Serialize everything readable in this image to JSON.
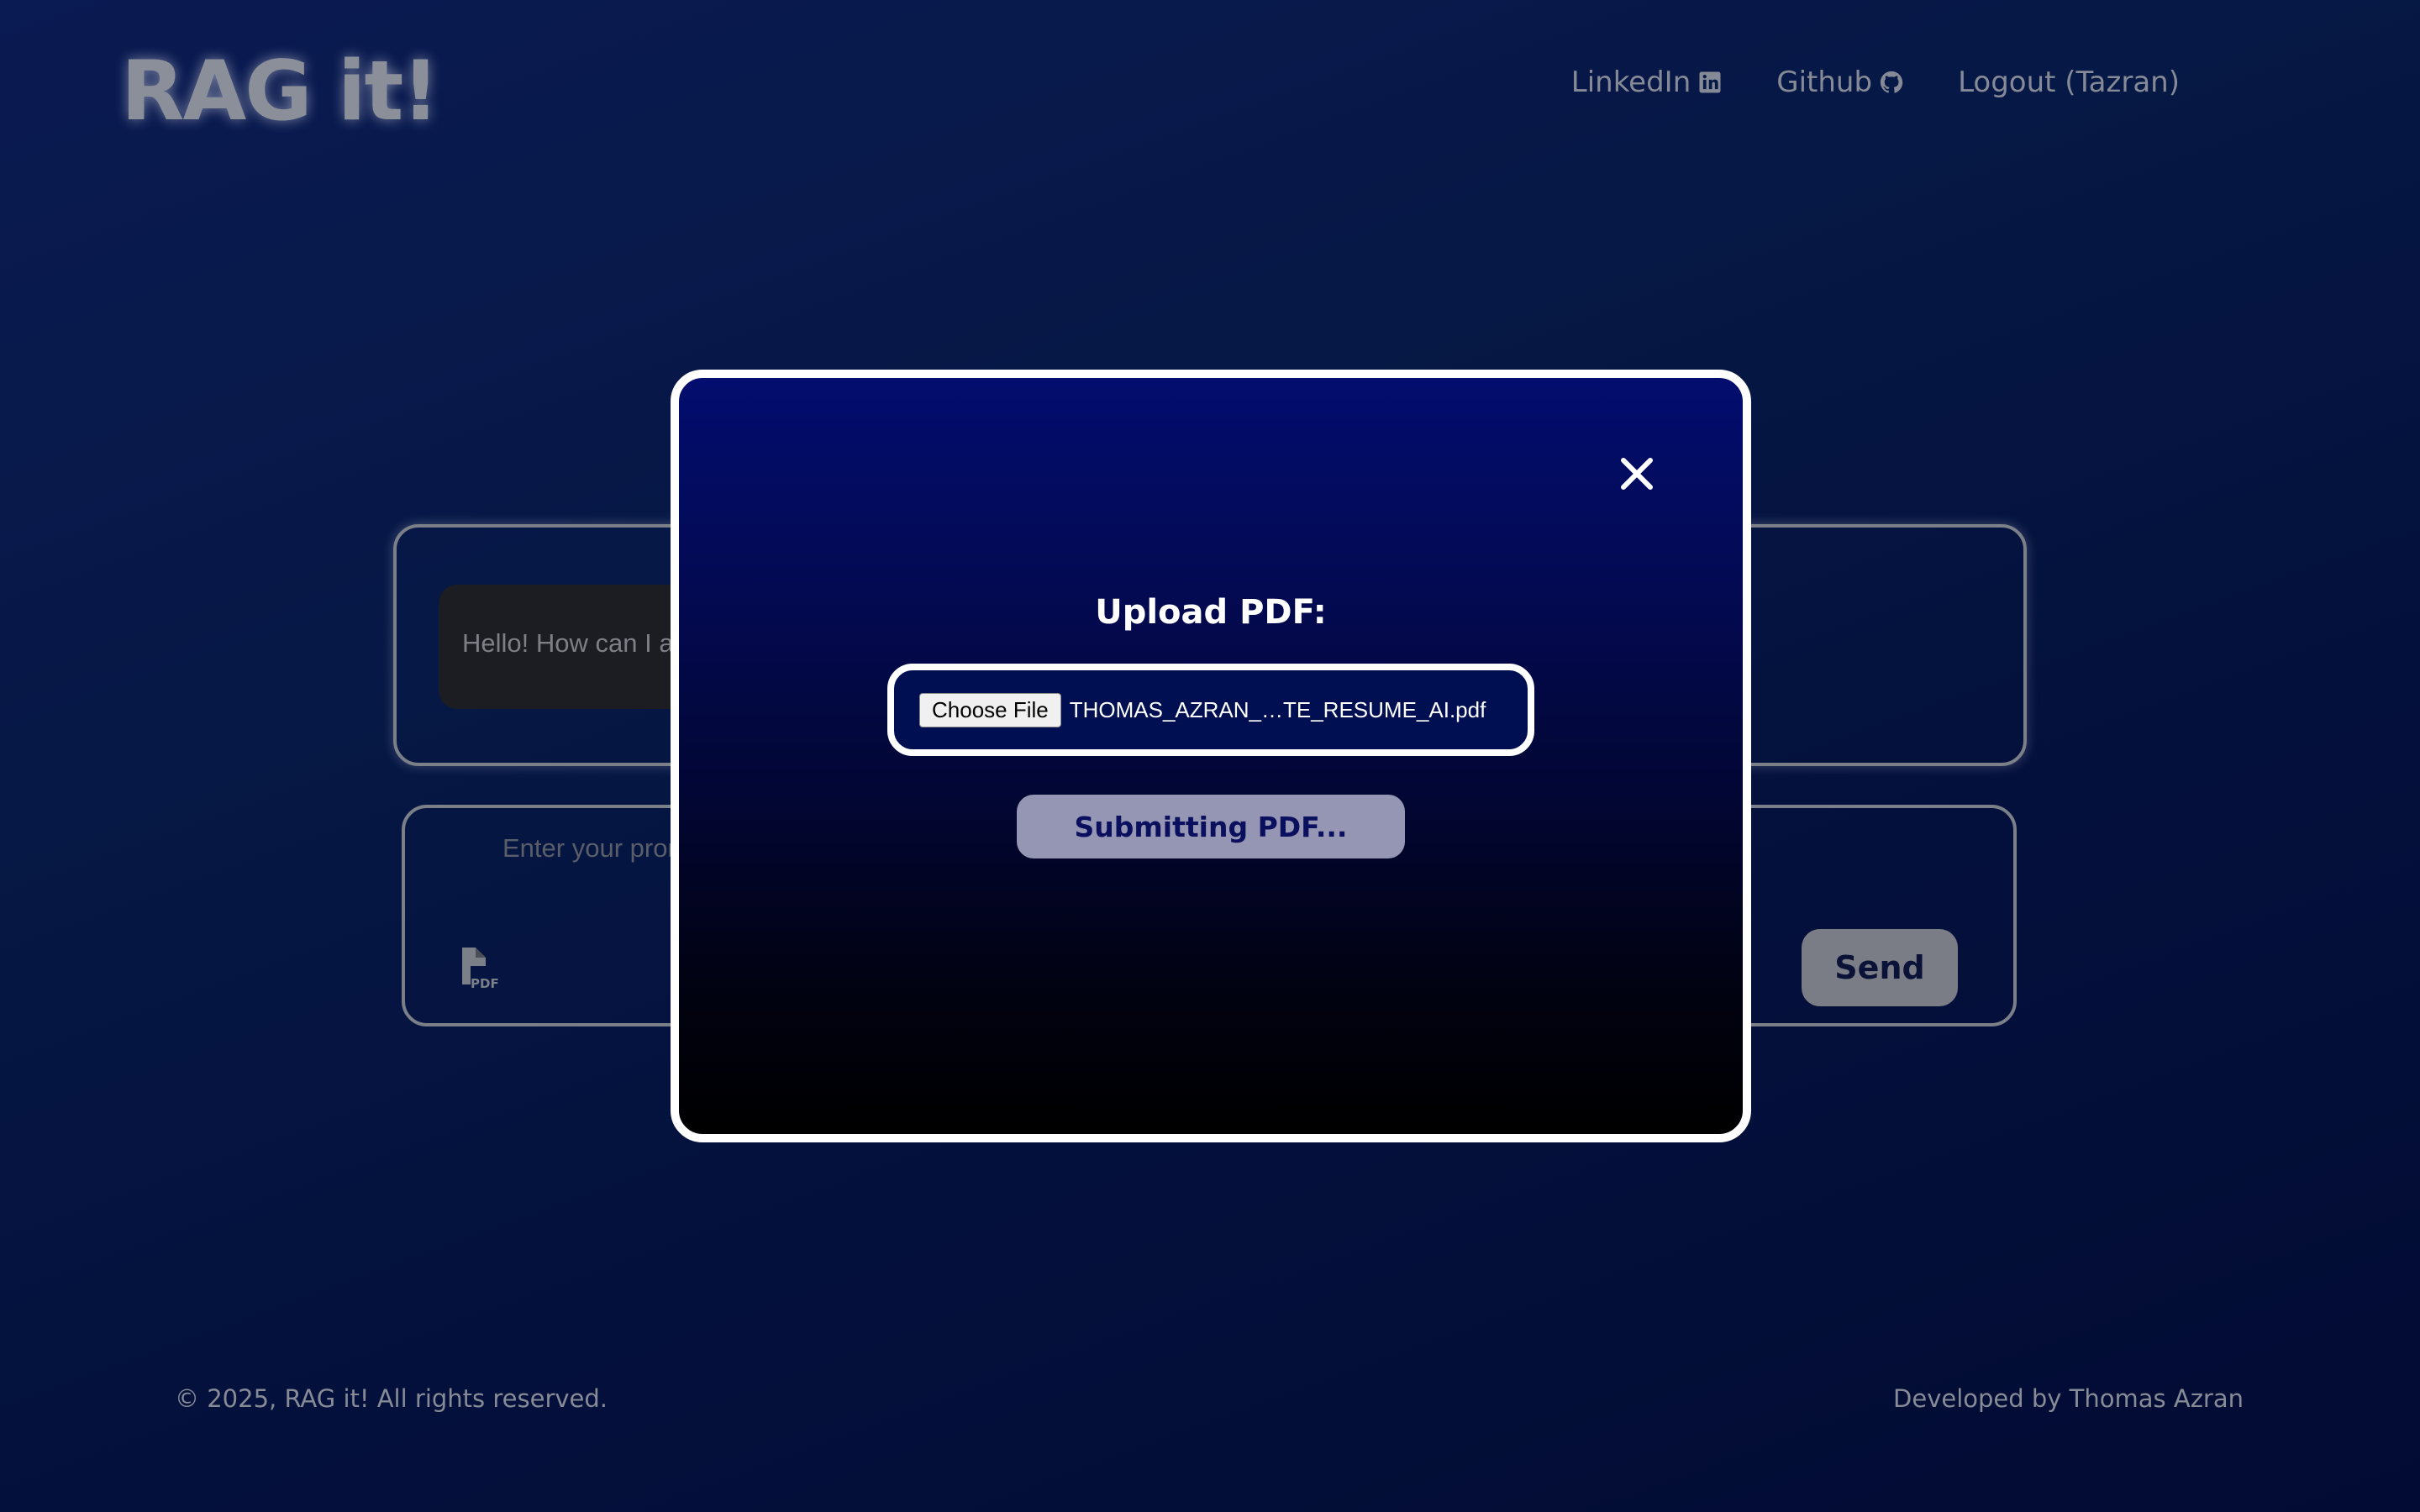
{
  "header": {
    "logo": "RAG it!",
    "nav": [
      {
        "label": "LinkedIn",
        "icon": "linkedin-icon"
      },
      {
        "label": "Github",
        "icon": "github-icon"
      },
      {
        "label": "Logout (Tazran)"
      }
    ]
  },
  "chat": {
    "greeting": "Hello! How can I assist you today?",
    "placeholder": "Enter your prompt...",
    "send_label": "Send",
    "pdf_icon_label": "PDF"
  },
  "modal": {
    "title": "Upload PDF:",
    "choose_file_label": "Choose File",
    "file_name": "THOMAS_AZRAN_…TE_RESUME_AI.pdf",
    "submit_label": "Submitting PDF..."
  },
  "footer": {
    "copyright": "© 2025, RAG it! All rights reserved.",
    "developer": "Developed by Thomas Azran"
  },
  "colors": {
    "background": "#04113d",
    "modal_top": "#020d6e",
    "modal_bottom": "#000000",
    "muted_text": "#858a96",
    "submit_bg": "#9496b4"
  }
}
